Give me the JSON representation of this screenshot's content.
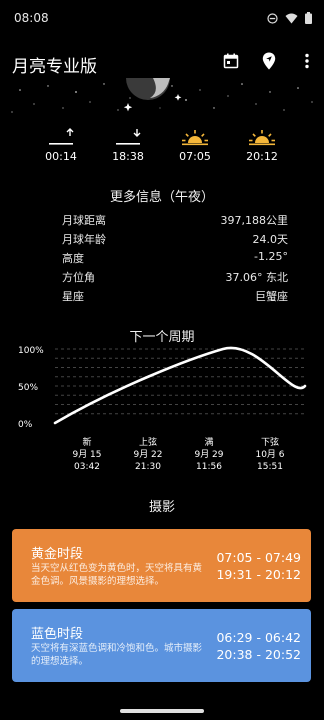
{
  "status": {
    "time": "08:08"
  },
  "app": {
    "title": "月亮专业版"
  },
  "events": [
    {
      "icon": "moonrise-icon",
      "time": "00:14"
    },
    {
      "icon": "moonset-icon",
      "time": "18:38"
    },
    {
      "icon": "sunrise-icon",
      "time": "07:05"
    },
    {
      "icon": "sunset-icon",
      "time": "20:12"
    }
  ],
  "info": {
    "title": "更多信息（午夜）",
    "rows": [
      {
        "label": "月球距离",
        "value": "397,188公里"
      },
      {
        "label": "月球年龄",
        "value": "24.0天"
      },
      {
        "label": "高度",
        "value": "-1.25°"
      },
      {
        "label": "方位角",
        "value": "37.06° 东北"
      },
      {
        "label": "星座",
        "value": "巨蟹座"
      }
    ]
  },
  "cycle": {
    "title": "下一个周期",
    "y_labels": [
      "100%",
      "50%",
      "0%"
    ],
    "phases": [
      {
        "name": "新",
        "date": "9月 15",
        "time": "03:42"
      },
      {
        "name": "上弦",
        "date": "9月 22",
        "time": "21:30"
      },
      {
        "name": "满",
        "date": "9月 29",
        "time": "11:56"
      },
      {
        "name": "下弦",
        "date": "10月 6",
        "time": "15:51"
      }
    ]
  },
  "chart_data": {
    "type": "line",
    "title": "下一个周期",
    "xlabel": "",
    "ylabel": "",
    "ylim": [
      0,
      100
    ],
    "y_ticks": [
      "100%",
      "50%",
      "0%"
    ],
    "categories": [
      "新 9月 15 03:42",
      "上弦 9月 22 21:30",
      "满 9月 29 11:56",
      "下弦 10月 6 15:51"
    ],
    "series": [
      {
        "values": [
          0,
          50,
          100,
          50
        ]
      }
    ],
    "line_color": "#ffffff",
    "grid": "dashed horizontal"
  },
  "photo": {
    "title": "摄影",
    "cards": [
      {
        "name": "黄金时段",
        "desc": "当天空从红色变为黄色时，天空将具有黄金色调。风景摄影的理想选择。",
        "time1": "07:05 - 07:49",
        "time2": "19:31 - 20:12",
        "color": "#e8873a"
      },
      {
        "name": "蓝色时段",
        "desc": "天空将有深蓝色调和冷饱和色。城市摄影的理想选择。",
        "time1": "06:29 - 06:42",
        "time2": "20:38 - 20:52",
        "color": "#5b93df"
      }
    ]
  }
}
